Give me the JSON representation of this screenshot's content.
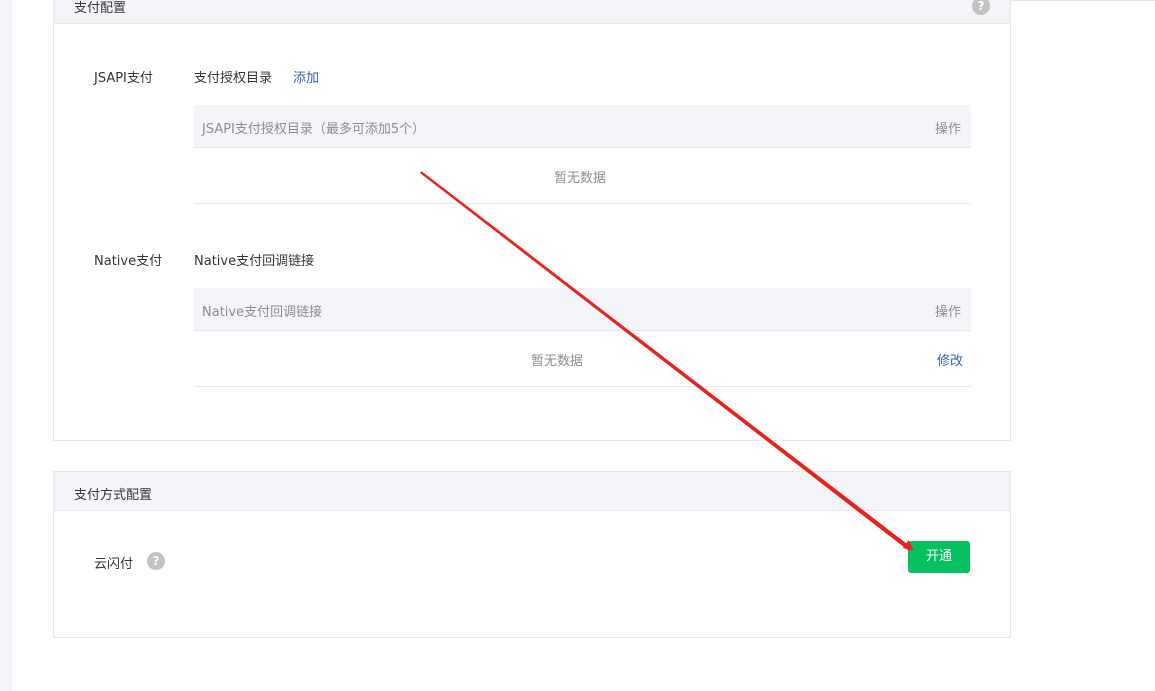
{
  "payment_config": {
    "title": "支付配置",
    "help_glyph": "?",
    "jsapi": {
      "label": "JSAPI支付",
      "subtitle": "支付授权目录",
      "add_link": "添加",
      "table": {
        "col_main": "JSAPI支付授权目录（最多可添加5个）",
        "col_action": "操作",
        "empty_text": "暂无数据"
      }
    },
    "native": {
      "label": "Native支付",
      "subtitle": "Native支付回调链接",
      "table": {
        "col_main": "Native支付回调链接",
        "col_action": "操作",
        "empty_text": "暂无数据",
        "edit_link": "修改"
      }
    }
  },
  "payment_method_config": {
    "title": "支付方式配置",
    "yunshanfu": {
      "label": "云闪付",
      "help_glyph": "?",
      "open_button": "开通"
    }
  },
  "colors": {
    "accent_green": "#07c160",
    "link_blue": "#3a64a6",
    "annotation_red": "#e8231c"
  },
  "icons": [
    "help-icon",
    "annotation-arrow"
  ]
}
